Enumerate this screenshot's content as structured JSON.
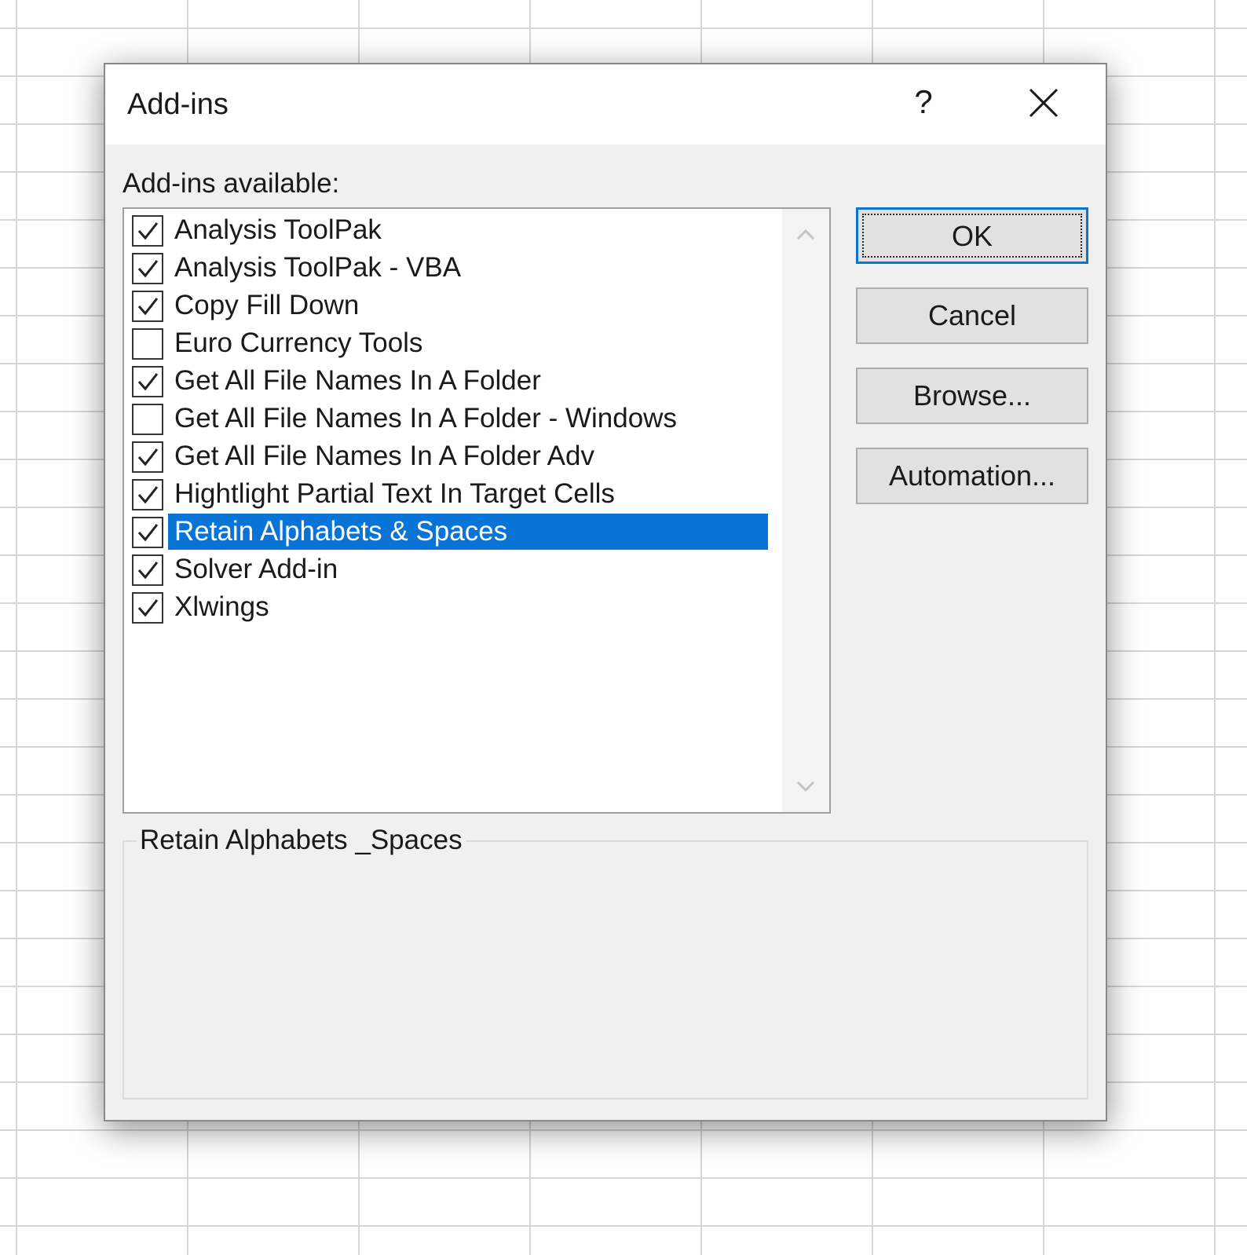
{
  "dialog": {
    "title": "Add-ins",
    "help_label": "?",
    "close_icon": "close-icon"
  },
  "list": {
    "label": "Add-ins available:",
    "items": [
      {
        "label": "Analysis ToolPak",
        "checked": true
      },
      {
        "label": "Analysis ToolPak - VBA",
        "checked": true
      },
      {
        "label": "Copy Fill Down",
        "checked": true
      },
      {
        "label": "Euro Currency Tools",
        "checked": false
      },
      {
        "label": "Get All File Names In A Folder",
        "checked": true
      },
      {
        "label": "Get All File Names In A Folder - Windows",
        "checked": false
      },
      {
        "label": "Get All File Names In A Folder Adv",
        "checked": true
      },
      {
        "label": "Hightlight Partial Text In Target Cells",
        "checked": true
      },
      {
        "label": "Retain Alphabets & Spaces",
        "checked": true,
        "selected": true
      },
      {
        "label": "Solver Add-in",
        "checked": true
      },
      {
        "label": "Xlwings",
        "checked": true
      }
    ]
  },
  "buttons": {
    "ok": "OK",
    "cancel": "Cancel",
    "browse": "Browse...",
    "automation": "Automation..."
  },
  "description": {
    "title": "Retain Alphabets _Spaces"
  },
  "colors": {
    "selection": "#0a74d6",
    "dialog_bg": "#f0f0f0"
  }
}
